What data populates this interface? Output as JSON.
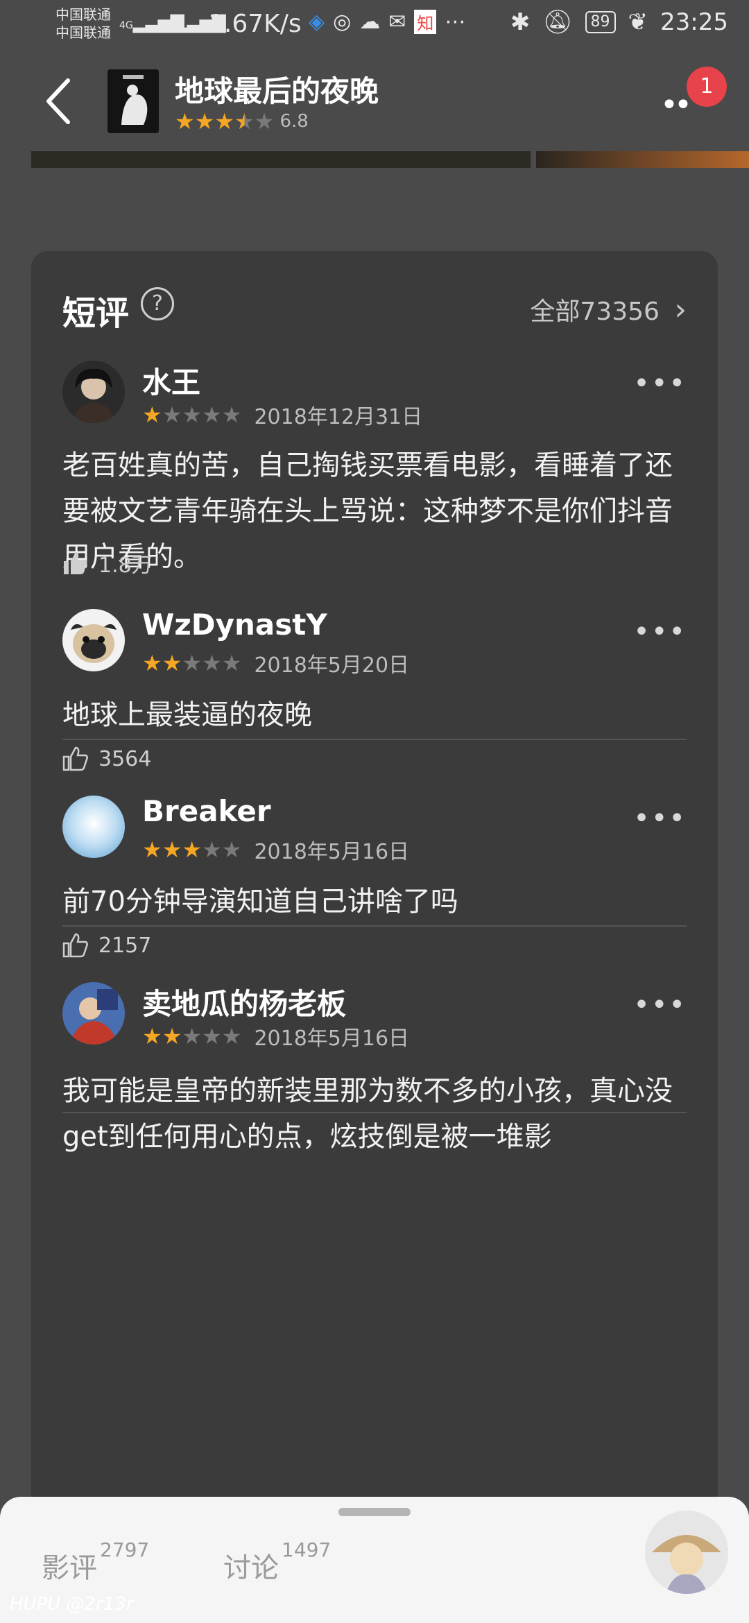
{
  "status_bar": {
    "carrier_top": "中国联通",
    "carrier_bottom": "中国联通",
    "sig1": "4G",
    "sig2": "4G",
    "speed": "1.67K/s",
    "battery": "89",
    "time": "23:25"
  },
  "header": {
    "title": "地球最后的夜晚",
    "score": "6.8",
    "rating_fraction": 0.7,
    "badge": "1"
  },
  "card": {
    "title": "短评",
    "help_glyph": "?",
    "all_label": "全部73356",
    "all_chevron": "›"
  },
  "reviews": [
    {
      "user": "水王",
      "stars": 1,
      "date": "2018年12月31日",
      "text": "老百姓真的苦，自己掏钱买票看电影，看睡着了还要被文艺青年骑在头上骂说：这种梦不是你们抖音用户看的。",
      "likes": "1.8万",
      "liked": true
    },
    {
      "user": "WzDynastY",
      "stars": 2,
      "date": "2018年5月20日",
      "text": "地球上最装逼的夜晚",
      "likes": "3564",
      "liked": false
    },
    {
      "user": "Breaker",
      "stars": 3,
      "date": "2018年5月16日",
      "text": "前70分钟导演知道自己讲啥了吗",
      "likes": "2157",
      "liked": false
    },
    {
      "user": "卖地瓜的杨老板",
      "stars": 2,
      "date": "2018年5月16日",
      "text": "我可能是皇帝的新装里那为数不多的小孩，真心没get到任何用心的点，炫技倒是被一堆影",
      "likes": "",
      "liked": false
    }
  ],
  "bottom_sheet": {
    "tab1_label": "影评",
    "tab1_count": "2797",
    "tab2_label": "讨论",
    "tab2_count": "1497"
  },
  "watermark": "HUPU @2r13r",
  "colors": {
    "background": "#4a4a4a",
    "card": "#3b3b3b",
    "star": "#f5a623",
    "badge": "#e8424a"
  }
}
